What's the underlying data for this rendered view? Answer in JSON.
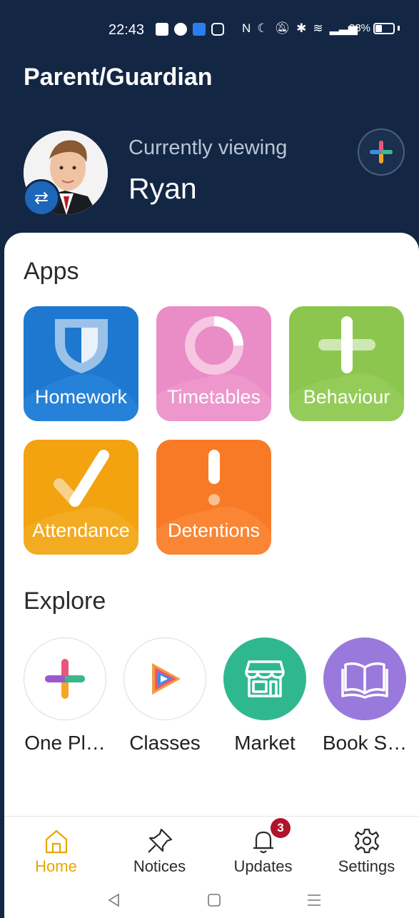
{
  "status_bar": {
    "time": "22:43",
    "battery_text": "38%",
    "battery_level_fraction": 0.38
  },
  "header": {
    "title": "Parent/Guardian",
    "viewing_label": "Currently viewing",
    "child_name": "Ryan"
  },
  "apps": {
    "title": "Apps",
    "items": [
      {
        "label": "Homework",
        "color": "#1f78cf"
      },
      {
        "label": "Timetables",
        "color": "#ea8cc6"
      },
      {
        "label": "Behaviour",
        "color": "#8dc64f"
      },
      {
        "label": "Attendance",
        "color": "#f2a30f"
      },
      {
        "label": "Detentions",
        "color": "#f97a26"
      }
    ]
  },
  "explore": {
    "title": "Explore",
    "items": [
      {
        "label": "One Pl…",
        "icon": "one-place-plus-icon"
      },
      {
        "label": "Classes",
        "icon": "classes-play-icon"
      },
      {
        "label": "Market",
        "icon": "market-store-icon",
        "color": "#2fb890"
      },
      {
        "label": "Book S…",
        "icon": "book-open-icon",
        "color": "#9a79dc"
      }
    ]
  },
  "bottom_nav": {
    "items": [
      {
        "label": "Home",
        "icon": "home-icon",
        "active": true
      },
      {
        "label": "Notices",
        "icon": "pin-icon"
      },
      {
        "label": "Updates",
        "icon": "bell-icon",
        "badge": "3"
      },
      {
        "label": "Settings",
        "icon": "gear-icon"
      }
    ]
  },
  "colors": {
    "header_bg": "#132744",
    "active_nav": "#e6a700",
    "badge": "#b0132a"
  }
}
